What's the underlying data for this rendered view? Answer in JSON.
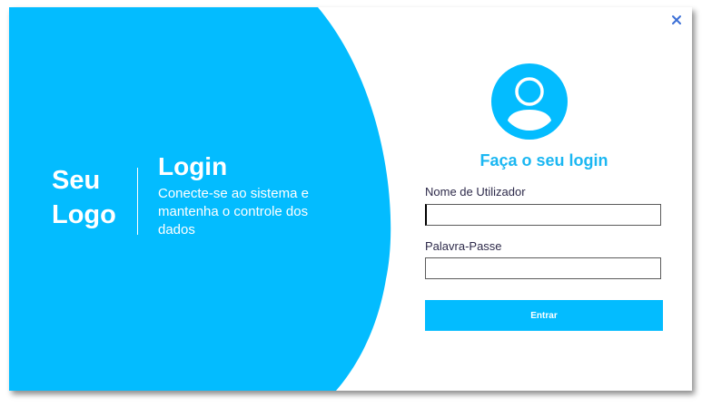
{
  "branding": {
    "logo_line1": "Seu",
    "logo_line2": "Logo"
  },
  "hero": {
    "heading": "Login",
    "description": "Conecte-se ao sistema e mantenha o controle dos dados"
  },
  "form": {
    "title": "Faça o seu login",
    "username_label": "Nome de Utilizador",
    "username_value": "",
    "password_label": "Palavra-Passe",
    "password_value": "",
    "submit_label": "Entrar"
  },
  "window": {
    "close_icon": "close-icon"
  },
  "colors": {
    "accent": "#03bcff",
    "title_text": "#1bb7f2",
    "label_text": "#2d2a4a",
    "close_icon": "#3b6fd6"
  }
}
